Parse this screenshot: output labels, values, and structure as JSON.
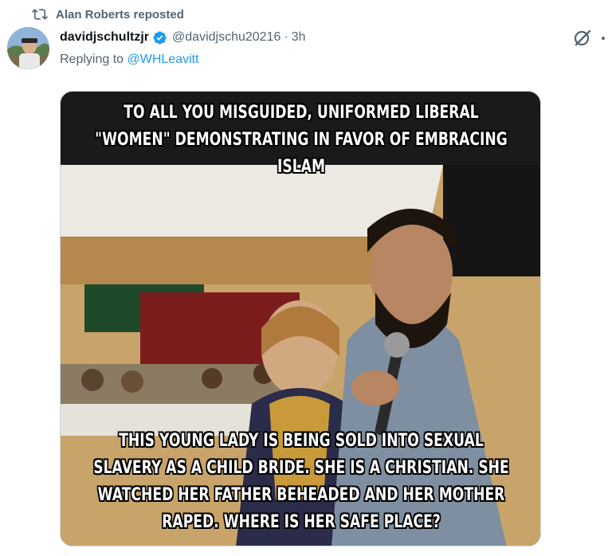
{
  "repost": {
    "icon": "repost-icon",
    "text": "Alan Roberts reposted"
  },
  "post": {
    "avatar_icon": "avatar",
    "display_name": "davidjschultzjr",
    "verified_icon": "verified-badge-icon",
    "handle": "@davidjschu20216",
    "separator": "·",
    "time": "3h",
    "replying_prefix": "Replying to ",
    "replying_handle": "@WHLeavitt",
    "grok_icon": "grok-icon",
    "more_icon": "more-options-icon"
  },
  "media": {
    "top_caption_line1": "TO ALL YOU MISGUIDED, UNIFORMED LIBERAL",
    "top_caption_line2": "\"WOMEN\" DEMONSTRATING IN FAVOR OF EMBRACING",
    "top_caption_line3": "ISLAM",
    "bottom_caption_line1": "THIS YOUNG LADY IS BEING SOLD INTO SEXUAL",
    "bottom_caption_line2": "SLAVERY AS A CHILD BRIDE. SHE IS A CHRISTIAN. SHE",
    "bottom_caption_line3": "WATCHED HER FATHER BEHEADED AND HER MOTHER",
    "bottom_caption_line4": "RAPED. WHERE IS HER SAFE PLACE?"
  },
  "colors": {
    "link": "#1d9bf0",
    "secondary_text": "#536471",
    "primary_text": "#0f1419",
    "verified": "#1d9bf0"
  }
}
